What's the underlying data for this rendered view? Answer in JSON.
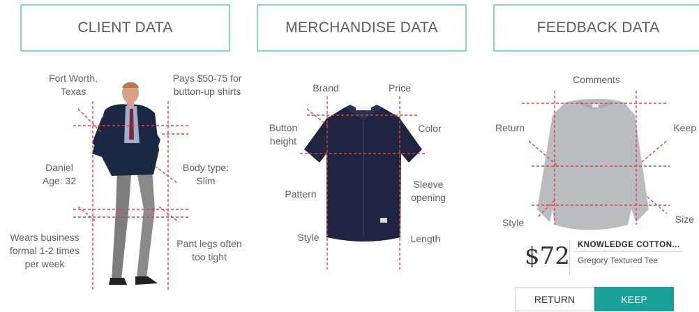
{
  "headers": {
    "client": "CLIENT DATA",
    "merchandise": "MERCHANDISE DATA",
    "feedback": "FEEDBACK DATA"
  },
  "client_labels": {
    "location": "Fort Worth,\nTexas",
    "price": "Pays $50-75 for\nbutton-up shirts",
    "name_age": "Daniel\nAge: 32",
    "body_type": "Body type:\nSlim",
    "business": "Wears business\nformal 1-2 times\nper week",
    "pant_legs": "Pant legs often\ntoo tight"
  },
  "merch_labels": {
    "brand": "Brand",
    "price": "Price",
    "button_height": "Button\nheight",
    "color": "Color",
    "pattern": "Pattern",
    "sleeve_opening": "Sleeve\nopening",
    "style": "Style",
    "length": "Length"
  },
  "feedback_labels": {
    "comments": "Comments",
    "return": "Return",
    "keep": "Keep",
    "style": "Style",
    "size": "Size"
  },
  "product": {
    "price": "$72",
    "name": "KNOWLEDGE COTTON...",
    "subtitle": "Gregory Textured Tee",
    "return_button": "RETURN",
    "keep_button": "KEEP"
  },
  "colors": {
    "header_border": "#8fd3c7",
    "dashed_line": "#e0413f",
    "keep_button": "#1aa19a",
    "shirt": "#1f2540",
    "sweater": "#b9bcc0"
  }
}
